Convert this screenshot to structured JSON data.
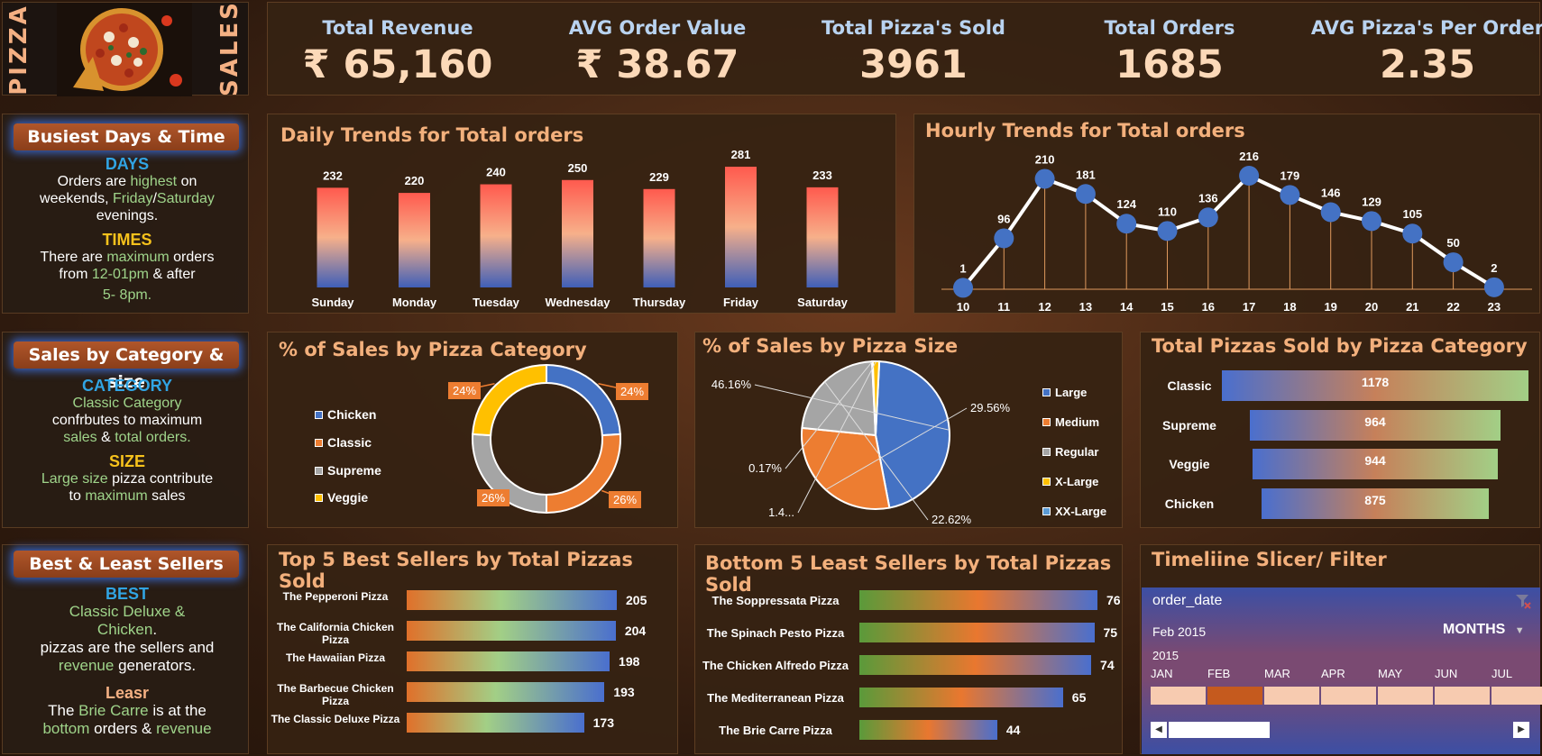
{
  "brand": {
    "left": "PIZZA",
    "right": "SALES"
  },
  "kpis": [
    {
      "label": "Total Revenue",
      "value": "₹ 65,160"
    },
    {
      "label": "AVG Order Value",
      "value": "₹ 38.67"
    },
    {
      "label": "Total Pizza's Sold",
      "value": "3961"
    },
    {
      "label": "Total Orders",
      "value": "1685"
    },
    {
      "label": "AVG Pizza's Per Order",
      "value": "2.35"
    }
  ],
  "busiest": {
    "title": "Busiest Days & Time",
    "days_heading": "DAYS",
    "days_t1": "Orders are ",
    "days_hl1": "highest",
    "days_t2": " on",
    "days_t3": "weekends, ",
    "days_hl2": "Friday",
    "days_t4": "/",
    "days_hl3": "Saturday",
    "days_t5": "evenings.",
    "times_heading": "TIMES",
    "times_t1": "There are ",
    "times_hl1": "maximum",
    "times_t2": " orders",
    "times_t3": "from ",
    "times_hl2": "12-01pm",
    "times_t4": " & after",
    "times_hl3": "5- 8pm."
  },
  "category_size": {
    "title": "Sales by Category & size",
    "cat_heading": "CATEGORY",
    "cat_l1": "Classic Category",
    "cat_l2": "confrbutes to maximum",
    "cat_hl1": "sales",
    "cat_t1": " & ",
    "cat_hl2": "total orders.",
    "size_heading": "SIZE",
    "size_hl1": "Large size",
    "size_t1": " pizza contribute",
    "size_t2": "to ",
    "size_hl2": "maximum",
    "size_t3": " sales"
  },
  "sellers": {
    "title": "Best & Least Sellers",
    "best_heading": "BEST",
    "best_l1": "Classic Deluxe &",
    "best_l2": "Chicken",
    "best_l2b": ".",
    "best_l3": "pizzas are the sellers and",
    "best_hl": "revenue",
    "best_l4": " generators",
    "best_dot": ".",
    "least_heading": "Leasr",
    "least_t1": "The ",
    "least_hl1": "Brie Carre",
    "least_t2": " is at the",
    "least_hl2": "bottom",
    "least_t3": " orders & ",
    "least_hl3": "revenue"
  },
  "daily": {
    "title": "Daily Trends for Total orders",
    "chart_data": {
      "type": "bar",
      "categories": [
        "Sunday",
        "Monday",
        "Tuesday",
        "Wednesday",
        "Thursday",
        "Friday",
        "Saturday"
      ],
      "values": [
        232,
        220,
        240,
        250,
        229,
        281,
        233
      ]
    }
  },
  "hourly": {
    "title": "Hourly Trends for Total orders",
    "chart_data": {
      "type": "line",
      "x": [
        10,
        11,
        12,
        13,
        14,
        15,
        16,
        17,
        18,
        19,
        20,
        21,
        22,
        23
      ],
      "values": [
        1,
        96,
        210,
        181,
        124,
        110,
        136,
        216,
        179,
        146,
        129,
        105,
        50,
        2
      ]
    }
  },
  "category_pct": {
    "title": "% of Sales by Pizza Category",
    "chart_data": {
      "type": "pie",
      "labels": [
        "Chicken",
        "Classic",
        "Supreme",
        "Veggie"
      ],
      "values": [
        24,
        26,
        26,
        24
      ],
      "display": [
        "24%",
        "26%",
        "26%",
        "24%"
      ],
      "colors": [
        "#4472c4",
        "#ed7d31",
        "#a5a5a5",
        "#ffc000"
      ]
    }
  },
  "size_pct": {
    "title": "% of Sales by Pizza Size",
    "chart_data": {
      "type": "pie",
      "labels": [
        "Large",
        "Medium",
        "Regular",
        "X-Large",
        "XX-Large"
      ],
      "values": [
        46.16,
        29.56,
        22.62,
        1.4,
        0.17
      ],
      "display": [
        "46.16%",
        "29.56%",
        "22.62%",
        "1.4...",
        "0.17%"
      ],
      "colors": [
        "#4472c4",
        "#ed7d31",
        "#a5a5a5",
        "#ffc000",
        "#5b9bd5"
      ]
    }
  },
  "total_by_category": {
    "title": "Total Pizzas Sold by Pizza Category",
    "chart_data": {
      "type": "bar",
      "categories": [
        "Classic",
        "Supreme",
        "Veggie",
        "Chicken"
      ],
      "values": [
        1178,
        964,
        944,
        875
      ]
    }
  },
  "top5": {
    "title": "Top 5 Best Sellers by Total Pizzas Sold",
    "chart_data": {
      "type": "bar",
      "categories": [
        "The Pepperoni Pizza",
        "The California Chicken Pizza",
        "The Hawaiian Pizza",
        "The Barbecue Chicken Pizza",
        "The Classic Deluxe Pizza"
      ],
      "values": [
        205,
        204,
        198,
        193,
        173
      ]
    }
  },
  "bottom5": {
    "title": "Bottom 5 Least Sellers by Total Pizzas Sold",
    "chart_data": {
      "type": "bar",
      "categories": [
        "The Soppressata Pizza",
        "The Spinach Pesto Pizza",
        "The Chicken Alfredo Pizza",
        "The Mediterranean Pizza",
        "The Brie Carre Pizza"
      ],
      "values": [
        76,
        75,
        74,
        65,
        44
      ]
    }
  },
  "timeline": {
    "title": "Timeliine Slicer/ Filter",
    "field": "order_date",
    "selected": "Feb 2015",
    "level": "MONTHS",
    "year": "2015",
    "months": [
      "JAN",
      "FEB",
      "MAR",
      "APR",
      "MAY",
      "JUN",
      "JUL"
    ],
    "selected_index": 1
  }
}
